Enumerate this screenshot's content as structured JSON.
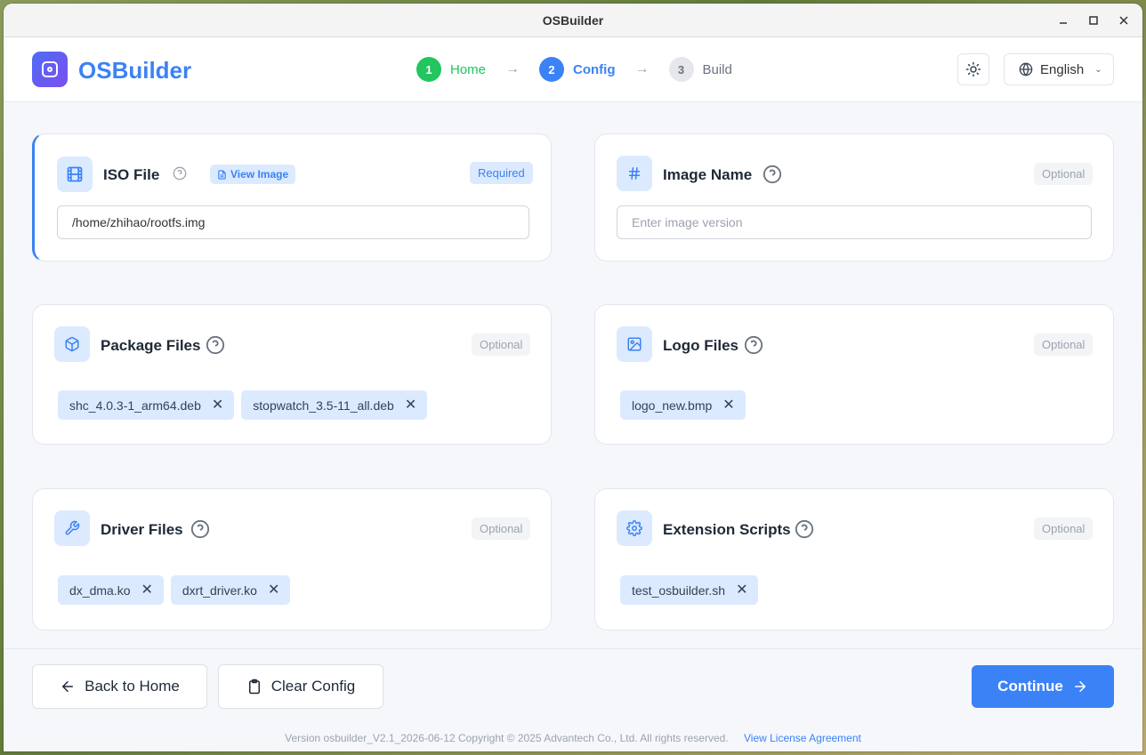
{
  "window": {
    "title": "OSBuilder"
  },
  "header": {
    "app_name": "OSBuilder",
    "steps": [
      {
        "num": "1",
        "label": "Home",
        "state": "done"
      },
      {
        "num": "2",
        "label": "Config",
        "state": "active"
      },
      {
        "num": "3",
        "label": "Build",
        "state": "todo"
      }
    ],
    "language": "English"
  },
  "cards": {
    "iso": {
      "title": "ISO File",
      "view_label": "View Image",
      "badge": "Required",
      "value": "/home/zhihao/rootfs.img"
    },
    "image_name": {
      "title": "Image Name",
      "badge": "Optional",
      "placeholder": "Enter image version",
      "value": ""
    },
    "packages": {
      "title": "Package Files",
      "badge": "Optional",
      "files": [
        "shc_4.0.3-1_arm64.deb",
        "stopwatch_3.5-11_all.deb"
      ]
    },
    "logo": {
      "title": "Logo Files",
      "badge": "Optional",
      "files": [
        "logo_new.bmp"
      ]
    },
    "drivers": {
      "title": "Driver Files",
      "badge": "Optional",
      "files": [
        "dx_dma.ko",
        "dxrt_driver.ko"
      ]
    },
    "scripts": {
      "title": "Extension Scripts",
      "badge": "Optional",
      "files": [
        "test_osbuilder.sh"
      ]
    }
  },
  "footer": {
    "back_label": "Back to Home",
    "clear_label": "Clear Config",
    "continue_label": "Continue",
    "copyright": "Version osbuilder_V2.1_2026-06-12 Copyright © 2025 Advantech Co., Ltd. All rights reserved.",
    "license_link": "View License Agreement"
  },
  "colors": {
    "accent": "#3b82f6",
    "success": "#22c55e",
    "chip_bg": "#dbeafe"
  }
}
